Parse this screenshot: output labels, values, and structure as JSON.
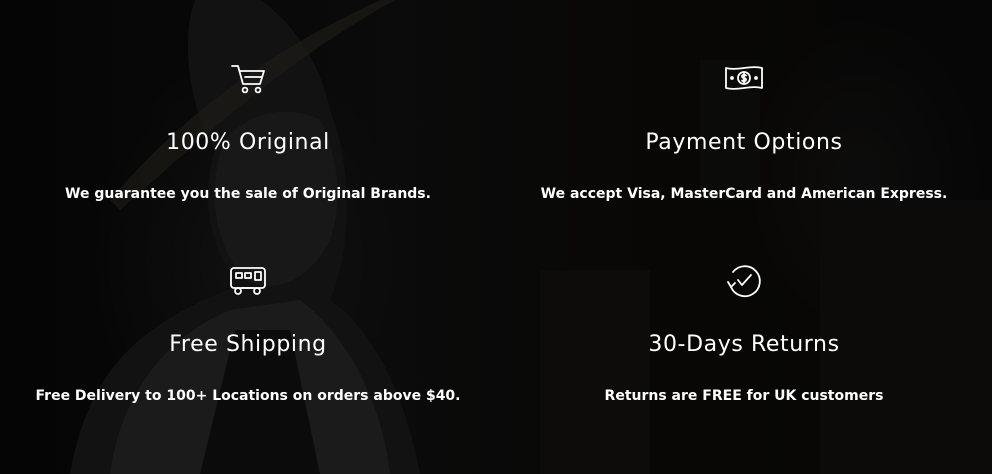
{
  "features": [
    {
      "icon": "cart-icon",
      "title": "100% Original",
      "description": "We guarantee you the sale of Original Brands."
    },
    {
      "icon": "banknote-icon",
      "title": "Payment Options",
      "description": "We accept Visa, MasterCard and American Express."
    },
    {
      "icon": "delivery-truck-icon",
      "title": "Free Shipping",
      "description": "Free Delivery to 100+ Locations on orders above $40."
    },
    {
      "icon": "returns-check-icon",
      "title": "30-Days Returns",
      "description": "Returns are FREE for UK customers"
    }
  ],
  "colors": {
    "text": "#ffffff",
    "background": "#0b0b0b"
  }
}
